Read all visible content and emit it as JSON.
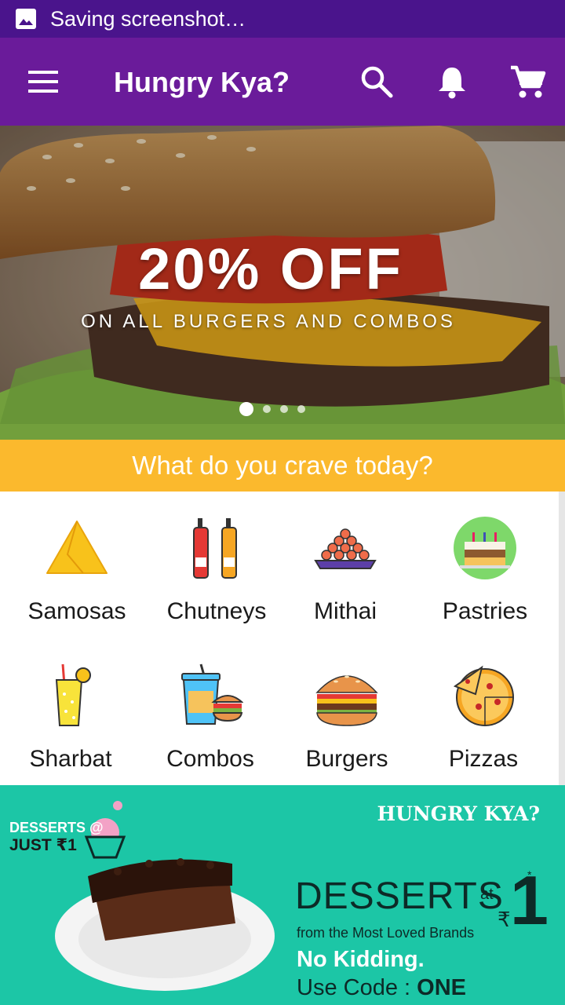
{
  "status_bar": {
    "text": "Saving screenshot…",
    "icon": "image-icon"
  },
  "app_bar": {
    "title": "Hungry Kya?",
    "menu_icon": "menu-icon",
    "actions": [
      "search-icon",
      "bell-icon",
      "cart-icon"
    ],
    "color": "#6a1b9a"
  },
  "banner": {
    "headline": "20% OFF",
    "subline": "ON ALL BURGERS AND COMBOS",
    "slides": 4,
    "active_slide": 1
  },
  "crave": {
    "text": "What do you crave today?",
    "color": "#fbb92d"
  },
  "categories": [
    {
      "label": "Samosas",
      "icon": "samosa-icon"
    },
    {
      "label": "Chutneys",
      "icon": "chutney-bottles-icon"
    },
    {
      "label": "Mithai",
      "icon": "mithai-icon"
    },
    {
      "label": "Pastries",
      "icon": "cake-icon"
    },
    {
      "label": "Sharbat",
      "icon": "drink-icon"
    },
    {
      "label": "Combos",
      "icon": "combo-icon"
    },
    {
      "label": "Burgers",
      "icon": "burger-icon"
    },
    {
      "label": "Pizzas",
      "icon": "pizza-icon"
    }
  ],
  "promo": {
    "brand": "HUNGRY KYA?",
    "tag_line_1": "DESSERTS @",
    "tag_line_2": "JUST ₹1",
    "big_text": "DESSERTS",
    "at_text": "at",
    "currency": "₹",
    "price": "1",
    "asterisk": "*",
    "from_text": "from the Most Loved Brands",
    "no_kidding": "No Kidding.",
    "code_prefix": "Use Code : ",
    "code": "ONE",
    "color": "#1cc6a6"
  }
}
